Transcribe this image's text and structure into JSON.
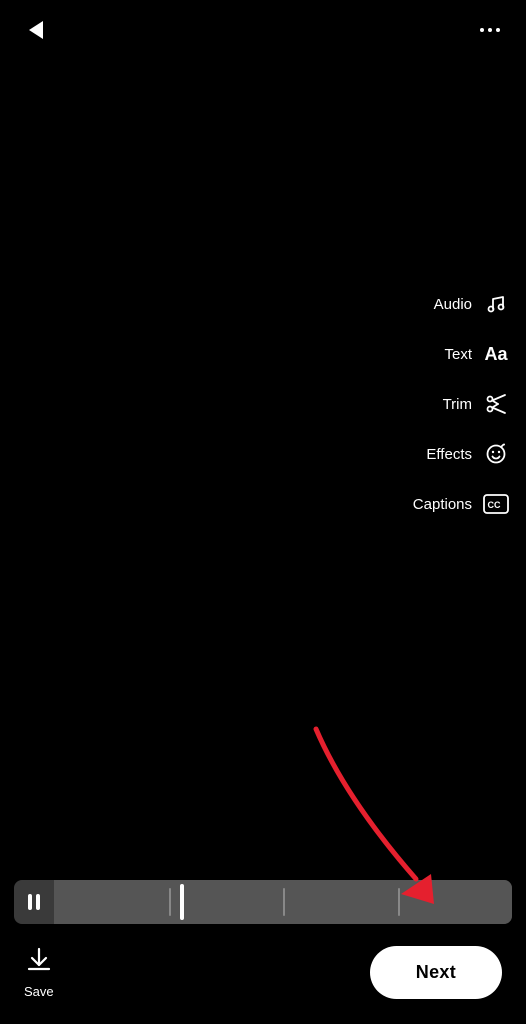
{
  "header": {
    "back_label": "back",
    "more_label": "more options"
  },
  "toolbar": {
    "items": [
      {
        "label": "Audio",
        "icon": "♩",
        "icon_name": "music-note-icon"
      },
      {
        "label": "Text",
        "icon": "Aa",
        "icon_name": "text-icon"
      },
      {
        "label": "Trim",
        "icon": "✂",
        "icon_name": "scissors-icon"
      },
      {
        "label": "Effects",
        "icon": "☺",
        "icon_name": "effects-icon"
      },
      {
        "label": "Captions",
        "icon": "CC",
        "icon_name": "captions-icon"
      }
    ]
  },
  "bottom": {
    "save_label": "Save",
    "next_label": "Next"
  }
}
